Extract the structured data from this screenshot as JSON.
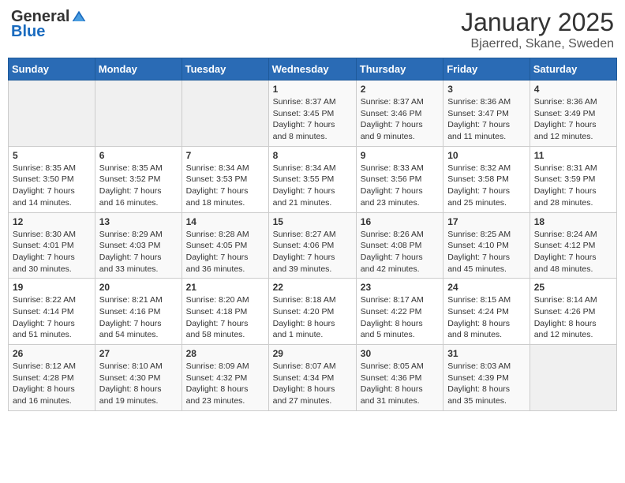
{
  "logo": {
    "general": "General",
    "blue": "Blue"
  },
  "title": {
    "month": "January 2025",
    "location": "Bjaerred, Skane, Sweden"
  },
  "weekdays": [
    "Sunday",
    "Monday",
    "Tuesday",
    "Wednesday",
    "Thursday",
    "Friday",
    "Saturday"
  ],
  "weeks": [
    [
      {
        "day": "",
        "info": ""
      },
      {
        "day": "",
        "info": ""
      },
      {
        "day": "",
        "info": ""
      },
      {
        "day": "1",
        "info": "Sunrise: 8:37 AM\nSunset: 3:45 PM\nDaylight: 7 hours\nand 8 minutes."
      },
      {
        "day": "2",
        "info": "Sunrise: 8:37 AM\nSunset: 3:46 PM\nDaylight: 7 hours\nand 9 minutes."
      },
      {
        "day": "3",
        "info": "Sunrise: 8:36 AM\nSunset: 3:47 PM\nDaylight: 7 hours\nand 11 minutes."
      },
      {
        "day": "4",
        "info": "Sunrise: 8:36 AM\nSunset: 3:49 PM\nDaylight: 7 hours\nand 12 minutes."
      }
    ],
    [
      {
        "day": "5",
        "info": "Sunrise: 8:35 AM\nSunset: 3:50 PM\nDaylight: 7 hours\nand 14 minutes."
      },
      {
        "day": "6",
        "info": "Sunrise: 8:35 AM\nSunset: 3:52 PM\nDaylight: 7 hours\nand 16 minutes."
      },
      {
        "day": "7",
        "info": "Sunrise: 8:34 AM\nSunset: 3:53 PM\nDaylight: 7 hours\nand 18 minutes."
      },
      {
        "day": "8",
        "info": "Sunrise: 8:34 AM\nSunset: 3:55 PM\nDaylight: 7 hours\nand 21 minutes."
      },
      {
        "day": "9",
        "info": "Sunrise: 8:33 AM\nSunset: 3:56 PM\nDaylight: 7 hours\nand 23 minutes."
      },
      {
        "day": "10",
        "info": "Sunrise: 8:32 AM\nSunset: 3:58 PM\nDaylight: 7 hours\nand 25 minutes."
      },
      {
        "day": "11",
        "info": "Sunrise: 8:31 AM\nSunset: 3:59 PM\nDaylight: 7 hours\nand 28 minutes."
      }
    ],
    [
      {
        "day": "12",
        "info": "Sunrise: 8:30 AM\nSunset: 4:01 PM\nDaylight: 7 hours\nand 30 minutes."
      },
      {
        "day": "13",
        "info": "Sunrise: 8:29 AM\nSunset: 4:03 PM\nDaylight: 7 hours\nand 33 minutes."
      },
      {
        "day": "14",
        "info": "Sunrise: 8:28 AM\nSunset: 4:05 PM\nDaylight: 7 hours\nand 36 minutes."
      },
      {
        "day": "15",
        "info": "Sunrise: 8:27 AM\nSunset: 4:06 PM\nDaylight: 7 hours\nand 39 minutes."
      },
      {
        "day": "16",
        "info": "Sunrise: 8:26 AM\nSunset: 4:08 PM\nDaylight: 7 hours\nand 42 minutes."
      },
      {
        "day": "17",
        "info": "Sunrise: 8:25 AM\nSunset: 4:10 PM\nDaylight: 7 hours\nand 45 minutes."
      },
      {
        "day": "18",
        "info": "Sunrise: 8:24 AM\nSunset: 4:12 PM\nDaylight: 7 hours\nand 48 minutes."
      }
    ],
    [
      {
        "day": "19",
        "info": "Sunrise: 8:22 AM\nSunset: 4:14 PM\nDaylight: 7 hours\nand 51 minutes."
      },
      {
        "day": "20",
        "info": "Sunrise: 8:21 AM\nSunset: 4:16 PM\nDaylight: 7 hours\nand 54 minutes."
      },
      {
        "day": "21",
        "info": "Sunrise: 8:20 AM\nSunset: 4:18 PM\nDaylight: 7 hours\nand 58 minutes."
      },
      {
        "day": "22",
        "info": "Sunrise: 8:18 AM\nSunset: 4:20 PM\nDaylight: 8 hours\nand 1 minute."
      },
      {
        "day": "23",
        "info": "Sunrise: 8:17 AM\nSunset: 4:22 PM\nDaylight: 8 hours\nand 5 minutes."
      },
      {
        "day": "24",
        "info": "Sunrise: 8:15 AM\nSunset: 4:24 PM\nDaylight: 8 hours\nand 8 minutes."
      },
      {
        "day": "25",
        "info": "Sunrise: 8:14 AM\nSunset: 4:26 PM\nDaylight: 8 hours\nand 12 minutes."
      }
    ],
    [
      {
        "day": "26",
        "info": "Sunrise: 8:12 AM\nSunset: 4:28 PM\nDaylight: 8 hours\nand 16 minutes."
      },
      {
        "day": "27",
        "info": "Sunrise: 8:10 AM\nSunset: 4:30 PM\nDaylight: 8 hours\nand 19 minutes."
      },
      {
        "day": "28",
        "info": "Sunrise: 8:09 AM\nSunset: 4:32 PM\nDaylight: 8 hours\nand 23 minutes."
      },
      {
        "day": "29",
        "info": "Sunrise: 8:07 AM\nSunset: 4:34 PM\nDaylight: 8 hours\nand 27 minutes."
      },
      {
        "day": "30",
        "info": "Sunrise: 8:05 AM\nSunset: 4:36 PM\nDaylight: 8 hours\nand 31 minutes."
      },
      {
        "day": "31",
        "info": "Sunrise: 8:03 AM\nSunset: 4:39 PM\nDaylight: 8 hours\nand 35 minutes."
      },
      {
        "day": "",
        "info": ""
      }
    ]
  ]
}
